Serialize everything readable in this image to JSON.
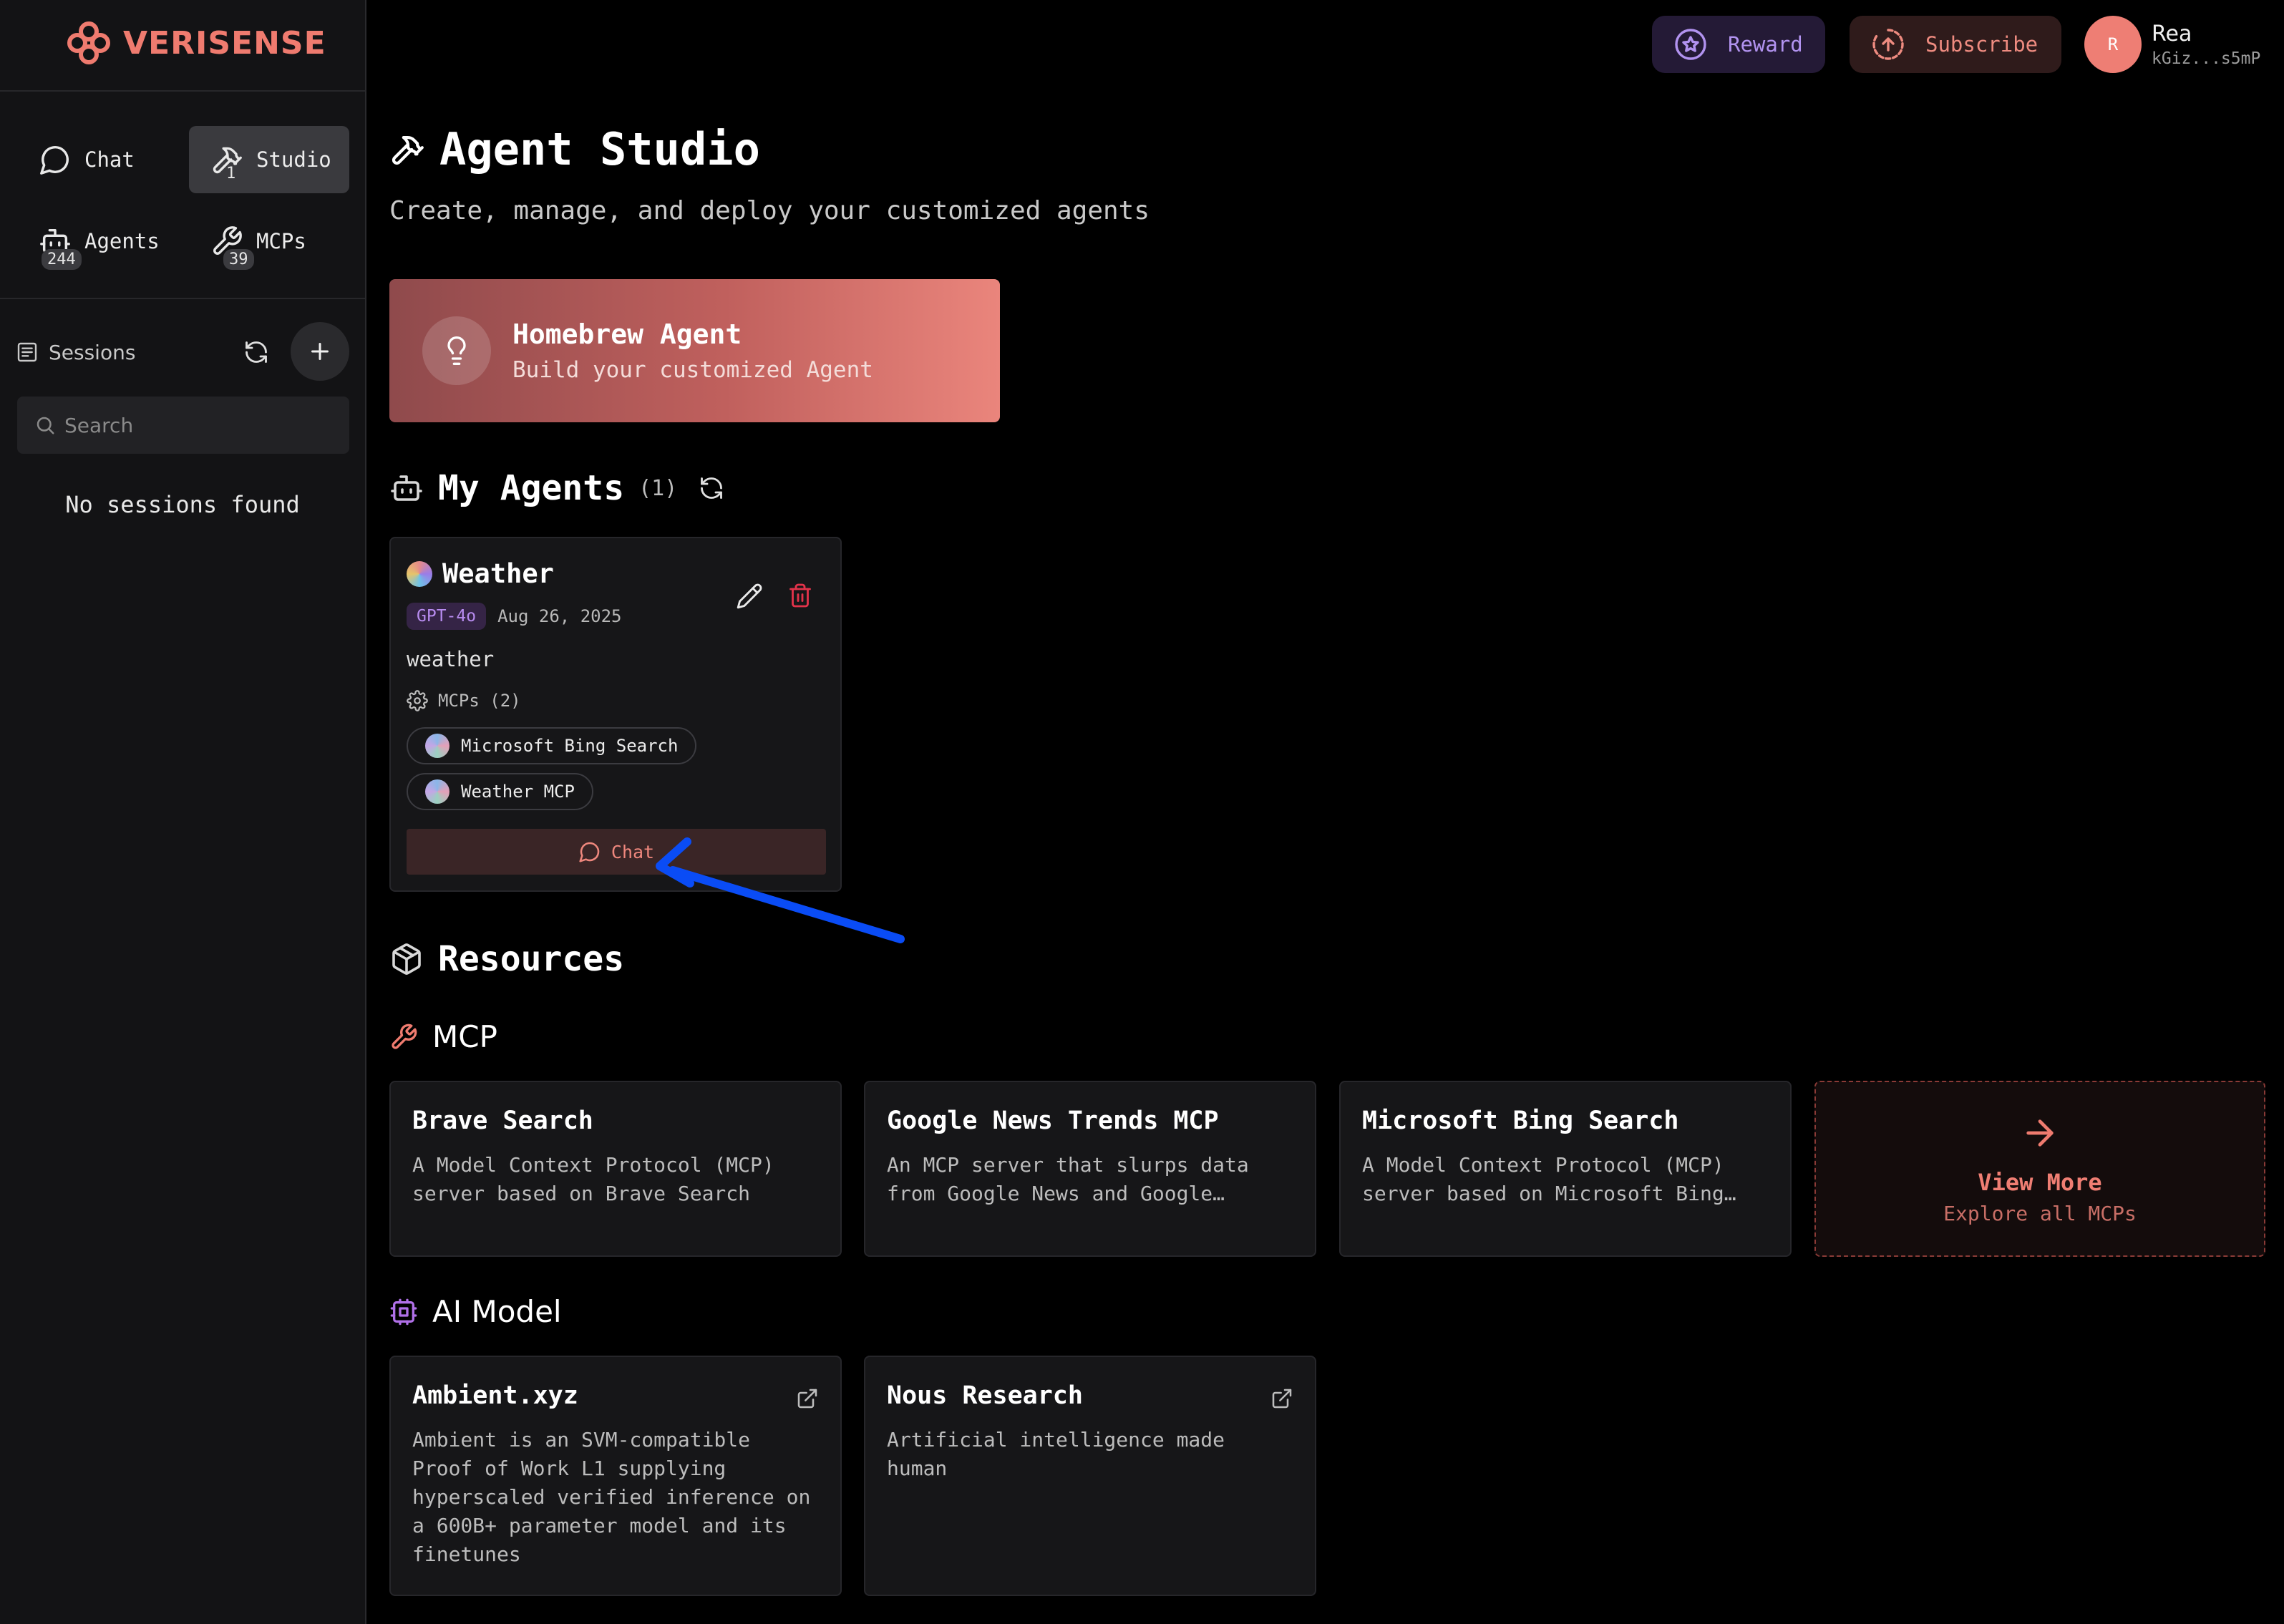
{
  "brand": {
    "name": "VERISENSE",
    "color": "#ef7b6f"
  },
  "sidebar": {
    "nav": [
      {
        "label": "Chat",
        "icon": "chat-bubble-icon"
      },
      {
        "label": "Studio",
        "icon": "hammer-icon",
        "badge": "1",
        "active": true
      },
      {
        "label": "Agents",
        "icon": "robot-icon",
        "badge": "244"
      },
      {
        "label": "MCPs",
        "icon": "wrench-icon",
        "badge": "39"
      }
    ],
    "sessions_label": "Sessions",
    "search_placeholder": "Search",
    "empty_text": "No sessions found"
  },
  "topbar": {
    "reward_label": "Reward",
    "subscribe_label": "Subscribe",
    "user_name": "Rea",
    "user_address": "kGiz...s5mP",
    "avatar_initial": "R"
  },
  "page": {
    "title": "Agent Studio",
    "subtitle": "Create, manage, and deploy your customized agents"
  },
  "homebrew": {
    "title": "Homebrew Agent",
    "subtitle": "Build your customized Agent"
  },
  "my_agents": {
    "title": "My Agents",
    "count": "(1)",
    "agents": [
      {
        "name": "Weather",
        "model": "GPT-4o",
        "date": "Aug 26, 2025",
        "description": "weather",
        "mcps_label": "MCPs (2)",
        "mcps": [
          "Microsoft Bing Search",
          "Weather MCP"
        ],
        "chat_label": "Chat"
      }
    ]
  },
  "resources": {
    "title": "Resources",
    "mcp_section": {
      "title": "MCP",
      "cards": [
        {
          "title": "Brave Search",
          "desc": "A Model Context Protocol (MCP) server based on Brave Search"
        },
        {
          "title": "Google News Trends MCP",
          "desc": "An MCP server that slurps data from Google News and Google…"
        },
        {
          "title": "Microsoft Bing Search",
          "desc": "A Model Context Protocol (MCP) server based on Microsoft Bing…"
        }
      ],
      "view_more": {
        "title": "View More",
        "subtitle": "Explore all MCPs"
      }
    },
    "ai_model_section": {
      "title": "AI Model",
      "cards": [
        {
          "title": "Ambient.xyz",
          "desc": "Ambient is an SVM-compatible Proof of Work L1 supplying hyperscaled verified inference on a 600B+ parameter model and its finetunes"
        },
        {
          "title": "Nous Research",
          "desc": "Artificial intelligence made human"
        }
      ]
    }
  },
  "colors": {
    "accent": "#ef7b6f",
    "purple": "#b88cf0",
    "annotation_arrow": "#0a4cf5"
  }
}
